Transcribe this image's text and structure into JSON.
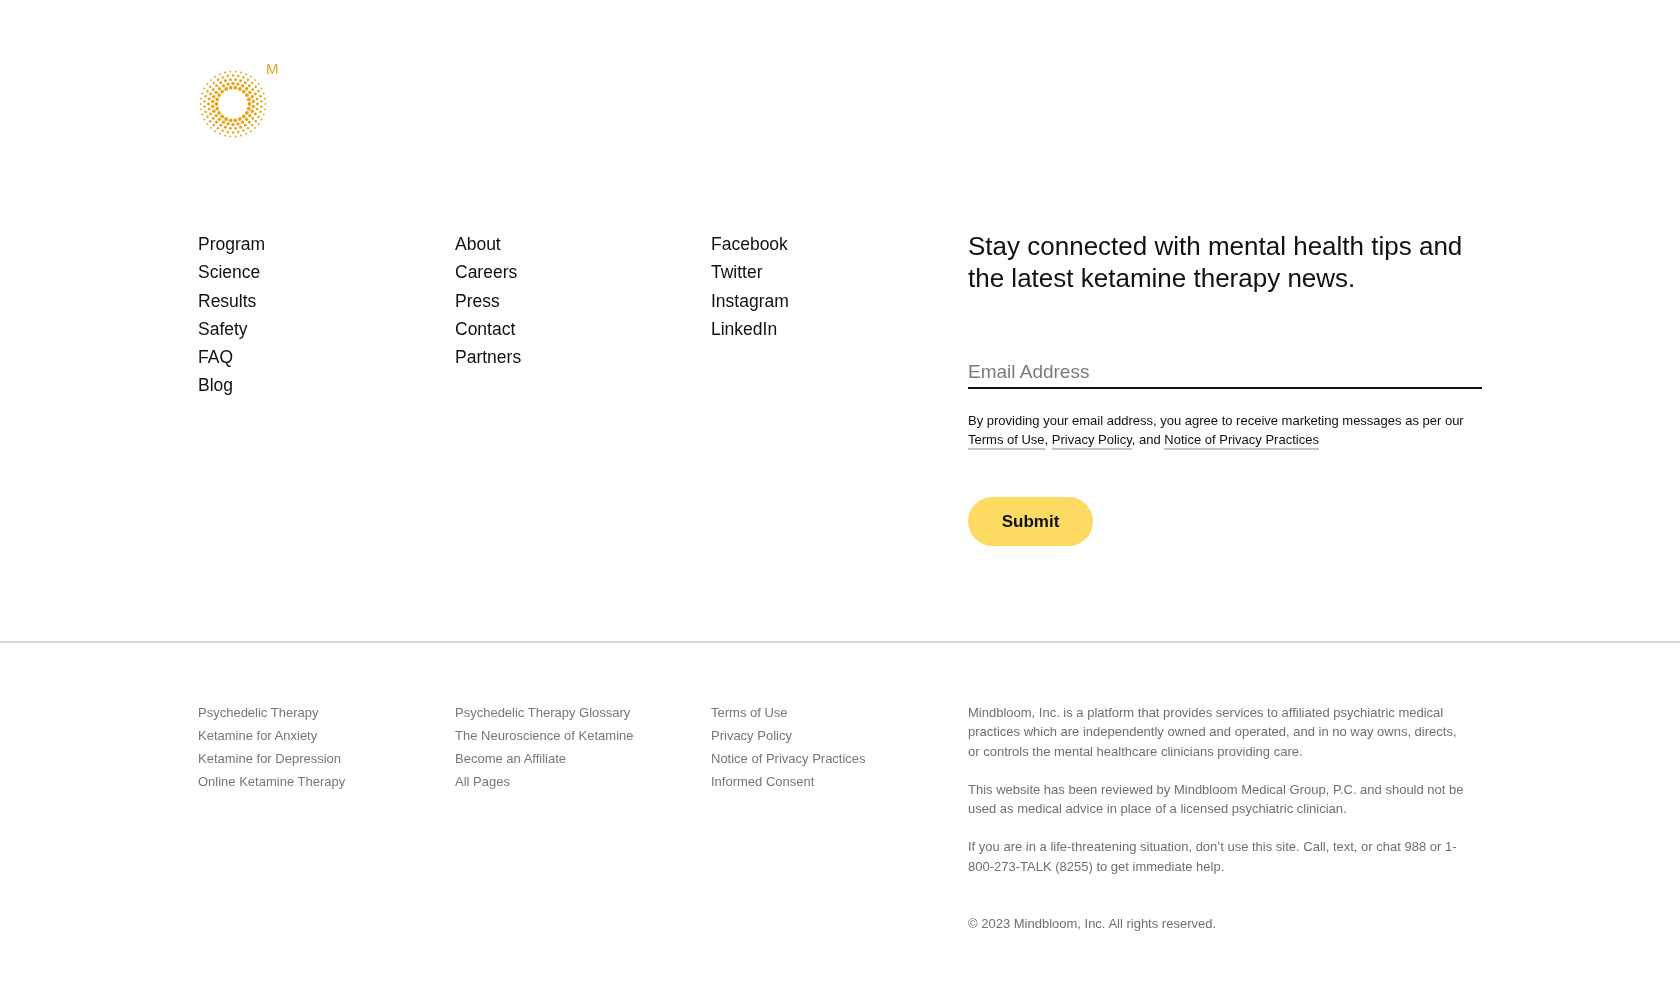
{
  "logo": {
    "letter": "M"
  },
  "nav_columns": [
    [
      "Program",
      "Science",
      "Results",
      "Safety",
      "FAQ",
      "Blog"
    ],
    [
      "About",
      "Careers",
      "Press",
      "Contact",
      "Partners"
    ],
    [
      "Facebook",
      "Twitter",
      "Instagram",
      "LinkedIn"
    ]
  ],
  "newsletter": {
    "heading": "Stay connected with mental health tips and the latest ketamine therapy news.",
    "email_field": {
      "placeholder": "Email Address"
    },
    "consent": [
      {
        "kind": "text",
        "text": "By providing your email address, you agree to receive marketing messages as per our "
      },
      {
        "kind": "link",
        "text": "Terms of Use"
      },
      {
        "kind": "text",
        "text": ", "
      },
      {
        "kind": "link",
        "text": "Privacy Policy"
      },
      {
        "kind": "text",
        "text": ", and "
      },
      {
        "kind": "link",
        "text": "Notice of Privacy Practices"
      }
    ],
    "submit_button": "Submit"
  },
  "footer_link_columns": [
    [
      "Psychedelic Therapy",
      "Ketamine for Anxiety",
      "Ketamine for Depression",
      "Online Ketamine Therapy"
    ],
    [
      "Psychedelic Therapy Glossary",
      "The Neuroscience of Ketamine",
      "Become an Affiliate",
      "All Pages"
    ],
    [
      "Terms of Use",
      "Privacy Policy",
      "Notice of Privacy Practices",
      "Informed Consent"
    ]
  ],
  "disclaimers": [
    "Mindbloom, Inc. is a platform that provides services to affiliated psychiatric medical practices which are independently owned and operated, and in no way owns, directs, or controls the mental healthcare clinicians providing care.",
    "This website has been reviewed by Mindbloom Medical Group, P.C. and should not be used as medical advice in place of a licensed psychiatric clinician.",
    "If you are in a life-threatening situation, don’t use this site. Call, text, or chat 988 or 1-800-273-TALK (8255) to get immediate help."
  ],
  "copyright": "© 2023 Mindbloom, Inc. All rights reserved."
}
